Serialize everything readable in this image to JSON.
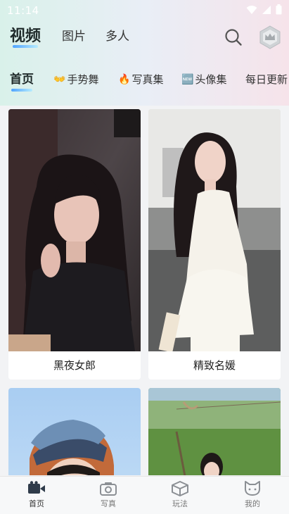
{
  "status_bar": {
    "time": "11:14"
  },
  "top_tabs": [
    {
      "label": "视频",
      "active": true
    },
    {
      "label": "图片",
      "active": false
    },
    {
      "label": "多人",
      "active": false
    }
  ],
  "categories": [
    {
      "label": "首页",
      "emoji": "",
      "active": true
    },
    {
      "label": "手势舞",
      "emoji": "👐",
      "active": false
    },
    {
      "label": "写真集",
      "emoji": "🔥",
      "active": false
    },
    {
      "label": "头像集",
      "emoji": "🆕",
      "active": false
    },
    {
      "label": "每日更新",
      "emoji": "",
      "active": false
    }
  ],
  "cards": [
    {
      "caption": "黑夜女郎"
    },
    {
      "caption": "精致名媛"
    },
    {
      "caption": ""
    },
    {
      "caption": ""
    }
  ],
  "tabbar": [
    {
      "label": "首页",
      "icon": "video-icon",
      "active": true
    },
    {
      "label": "写真",
      "icon": "camera-icon",
      "active": false
    },
    {
      "label": "玩法",
      "icon": "cube-icon",
      "active": false
    },
    {
      "label": "我的",
      "icon": "cat-face-icon",
      "active": false
    }
  ],
  "colors": {
    "accent_underline": "#4fa3ff",
    "header_gradient": [
      "#d9f1ea",
      "#f6e3ea"
    ]
  }
}
